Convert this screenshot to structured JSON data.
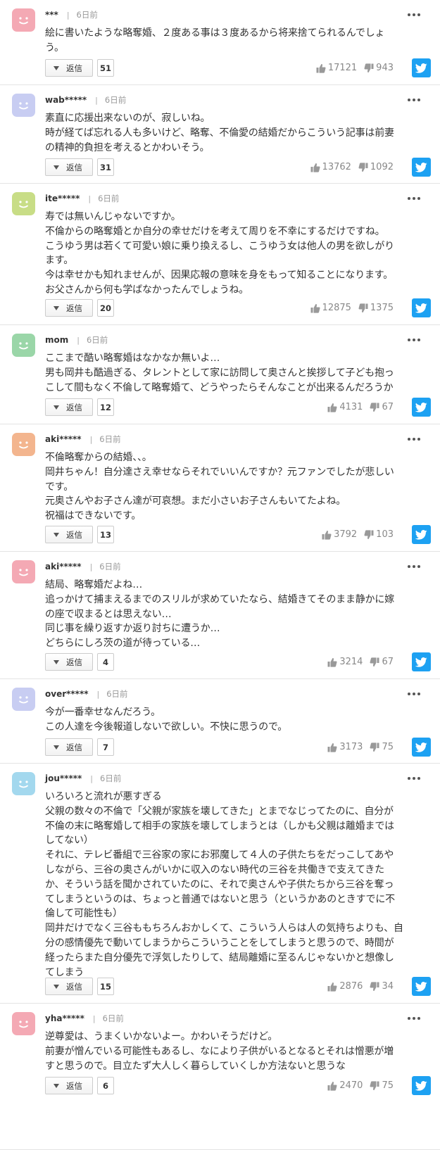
{
  "comments": [
    {
      "username": "***",
      "time": "6日前",
      "avatar_color": "#f4a9b4",
      "lines": [
        "絵に書いたような略奪婚、２度ある事は３度あるから将来捨てられるんでしょ",
        "う。"
      ],
      "reply_label": "返信",
      "reply_count": "51",
      "likes": "17121",
      "dislikes": "943"
    },
    {
      "username": "wab*****",
      "time": "6日前",
      "avatar_color": "#c8cdf2",
      "lines": [
        "素直に応援出来ないのが、寂しいね。",
        "時が経てば忘れる人も多いけど、略奪、不倫愛の結婚だからこういう記事は前妻",
        "の精神的負担を考えるとかわいそう。"
      ],
      "reply_label": "返信",
      "reply_count": "31",
      "likes": "13762",
      "dislikes": "1092"
    },
    {
      "username": "ite*****",
      "time": "6日前",
      "avatar_color": "#c8dd86",
      "lines": [
        "寿では無いんじゃないですか。",
        "不倫からの略奪婚とか自分の幸せだけを考えて周りを不幸にするだけですね。",
        "こうゆう男は若くて可愛い娘に乗り換えるし、こうゆう女は他人の男を欲しがり",
        "ます。",
        "今は幸せかも知れませんが、因果応報の意味を身をもって知ることになります。",
        "お父さんから何も学ばなかったんでしょうね。"
      ],
      "reply_label": "返信",
      "reply_count": "20",
      "likes": "12875",
      "dislikes": "1375"
    },
    {
      "username": "mom",
      "time": "6日前",
      "avatar_color": "#9ad6a8",
      "lines": [
        "ここまで酷い略奪婚はなかなか無いよ…",
        "男も岡井も酷過ぎる、タレントとして家に訪問して奥さんと挨拶して子ども抱っ",
        "こして間もなく不倫して略奪婚て、どうやったらそんなことが出来るんだろうか"
      ],
      "reply_label": "返信",
      "reply_count": "12",
      "likes": "4131",
      "dislikes": "67"
    },
    {
      "username": "aki*****",
      "time": "6日前",
      "avatar_color": "#f3b58e",
      "lines": [
        "不倫略奪からの結婚、、。",
        "岡井ちゃん！自分達さえ幸せならそれでいいんですか？元ファンでしたが悲しい",
        "です。",
        "元奥さんやお子さん達が可哀想。まだ小さいお子さんもいてたよね。",
        "祝福はできないです。"
      ],
      "reply_label": "返信",
      "reply_count": "13",
      "likes": "3792",
      "dislikes": "103"
    },
    {
      "username": "aki*****",
      "time": "6日前",
      "avatar_color": "#f4a9b4",
      "lines": [
        "結局、略奪婚だよね…",
        "追っかけて捕まえるまでのスリルが求めていたなら、結婚きてそのまま静かに嫁",
        "の座で収まるとは思えない…",
        "同じ事を繰り返すか返り討ちに遭うか…",
        "どちらにしろ茨の道が待っている…"
      ],
      "reply_label": "返信",
      "reply_count": "4",
      "likes": "3214",
      "dislikes": "67"
    },
    {
      "username": "over*****",
      "time": "6日前",
      "avatar_color": "#c8cdf2",
      "lines": [
        "今が一番幸せなんだろう。",
        "この人達を今後報道しないで欲しい。不快に思うので。"
      ],
      "reply_label": "返信",
      "reply_count": "7",
      "likes": "3173",
      "dislikes": "75"
    },
    {
      "username": "jou*****",
      "time": "6日前",
      "avatar_color": "#a3d8ee",
      "lines": [
        "いろいろと流れが悪すぎる",
        "父親の数々の不倫で「父親が家族を壊してきた」とまでなじってたのに、自分が",
        "不倫の末に略奪婚して相手の家族を壊してしまうとは（しかも父親は離婚までは",
        "してない）",
        "それに、テレビ番組で三谷家の家にお邪魔して４人の子供たちをだっこしてあや",
        "しながら、三谷の奥さんがいかに収入のない時代の三谷を共働きで支えてきた",
        "か、そういう話を聞かされていたのに、それで奥さんや子供たちから三谷を奪っ",
        "てしまうというのは、ちょっと普通ではないと思う（というかあのときすでに不",
        "倫して可能性も）",
        "岡井だけでなく三谷ももちろんおかしくて、こういう人らは人の気持ちよりも、自",
        "分の感情優先で動いてしまうからこういうことをしてしまうと思うので、時間が",
        "経ったらまた自分優先で浮気したりして、結局離婚に至るんじゃないかと想像し",
        "てしまう"
      ],
      "reply_label": "返信",
      "reply_count": "15",
      "likes": "2876",
      "dislikes": "34"
    },
    {
      "username": "yha*****",
      "time": "6日前",
      "avatar_color": "#f4a9b4",
      "lines": [
        "逆尊愛は、うまくいかないよー。かわいそうだけど。",
        "前妻が憎んでいる可能性もあるし、なにより子供がいるとなるとそれは憎悪が増",
        "すと思うので。目立たず大人しく暮らしていくしか方法ないと思うな"
      ],
      "reply_label": "返信",
      "reply_count": "6",
      "likes": "2470",
      "dislikes": "75"
    }
  ]
}
